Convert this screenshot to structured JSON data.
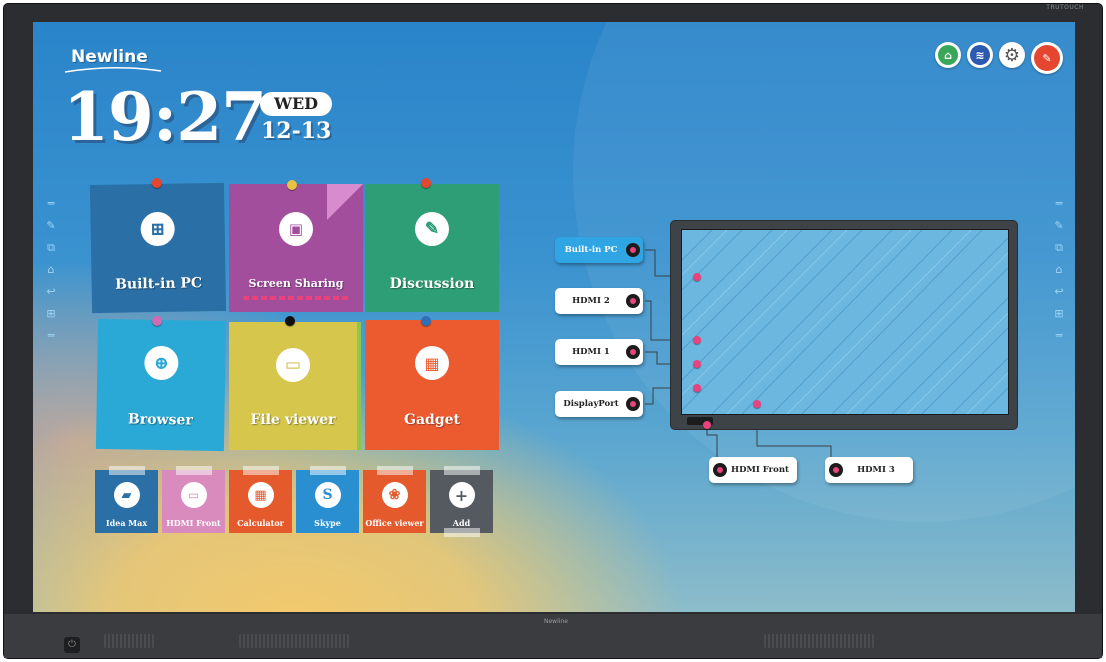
{
  "bezel": {
    "brand": "TRUTOUCH",
    "chin_logo": "Newline"
  },
  "header": {
    "logo": "Newline",
    "time": "19:27",
    "day": "WED",
    "date": "12-13"
  },
  "top_icons": [
    {
      "name": "usb",
      "color": "#3aa65a"
    },
    {
      "name": "wireless",
      "color": "#2c5ab0"
    },
    {
      "name": "settings",
      "color": "#888888"
    },
    {
      "name": "note",
      "color": "#e5462f"
    }
  ],
  "tiles": {
    "builtin_pc": {
      "label": "Built-in PC",
      "color": "#2a6fa5",
      "pin": "#e5462f"
    },
    "screen_sharing": {
      "label": "Screen Sharing",
      "color": "#a24e9c",
      "pin": "#e8c340"
    },
    "discussion": {
      "label": "Discussion",
      "color": "#2e9e76",
      "pin": "#e5462f"
    },
    "browser": {
      "label": "Browser",
      "color": "#2aa9d6",
      "pin": "#d06bb2"
    },
    "file_viewer": {
      "label": "File viewer",
      "color": "#d6c74c",
      "pin": "#111111"
    },
    "gadget": {
      "label": "Gadget",
      "color": "#ec5a2f",
      "pin": "#2f6fb5"
    }
  },
  "apps": [
    {
      "label": "Idea Max",
      "color": "#2a6fa5"
    },
    {
      "label": "HDMI Front",
      "color": "#d98bbd"
    },
    {
      "label": "Calculator",
      "color": "#e45a2c"
    },
    {
      "label": "Skype",
      "color": "#2a8fd0"
    },
    {
      "label": "Office viewer",
      "color": "#e45a2c"
    },
    {
      "label": "Add",
      "color": "#555a60"
    }
  ],
  "sources": {
    "builtin_pc": "Built-in PC",
    "hdmi2": "HDMI 2",
    "hdmi1": "HDMI 1",
    "displayport": "DisplayPort",
    "hdmi_front": "HDMI Front",
    "hdmi3": "HDMI 3"
  }
}
